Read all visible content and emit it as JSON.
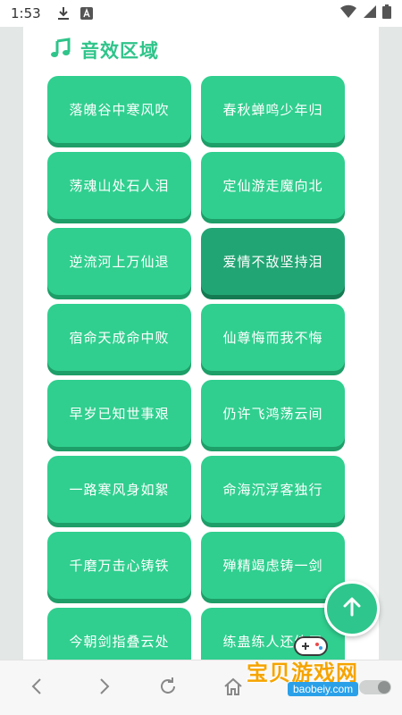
{
  "status_bar": {
    "time": "1:53",
    "icons": [
      "download-icon",
      "app-a-icon",
      "wifi-icon",
      "signal-icon",
      "battery-icon"
    ]
  },
  "section": {
    "title": "音效区域",
    "icon": "music-note-icon",
    "accent": "#2fc48a"
  },
  "sounds": [
    {
      "label": "落魄谷中寒风吹",
      "active": false
    },
    {
      "label": "春秋蝉鸣少年归",
      "active": false
    },
    {
      "label": "荡魂山处石人泪",
      "active": false
    },
    {
      "label": "定仙游走魔向北",
      "active": false
    },
    {
      "label": "逆流河上万仙退",
      "active": false
    },
    {
      "label": "爱情不敌坚持泪",
      "active": true
    },
    {
      "label": "宿命天成命中败",
      "active": false
    },
    {
      "label": "仙尊悔而我不悔",
      "active": false
    },
    {
      "label": "早岁已知世事艰",
      "active": false
    },
    {
      "label": "仍许飞鸿荡云间",
      "active": false
    },
    {
      "label": "一路寒风身如絮",
      "active": false
    },
    {
      "label": "命海沉浮客独行",
      "active": false
    },
    {
      "label": "千磨万击心铸铁",
      "active": false
    },
    {
      "label": "殚精竭虑铸一剑",
      "active": false
    },
    {
      "label": "今朝剑指叠云处",
      "active": false
    },
    {
      "label": "练蛊练人还练天",
      "active": false
    }
  ],
  "colors": {
    "button": "#30cf8f",
    "button_shadow": "#1e9e68",
    "button_active": "#22a574"
  },
  "nav": {
    "icons": [
      "back-icon",
      "forward-icon",
      "refresh-icon",
      "home-icon"
    ]
  },
  "fab": {
    "icon": "arrow-up-icon"
  },
  "watermark": {
    "title": "宝贝游戏网",
    "url": "baobeiy.com"
  }
}
